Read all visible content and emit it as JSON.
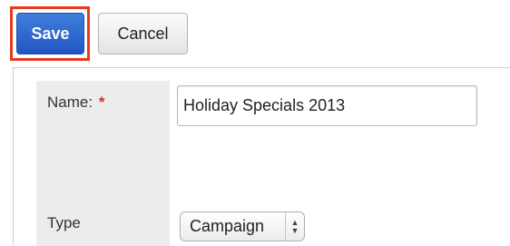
{
  "toolbar": {
    "save_label": "Save",
    "cancel_label": "Cancel",
    "highlight_color": "#e8391d",
    "save_color": "#2a62cc"
  },
  "form": {
    "name_label": "Name:",
    "required_marker": "*",
    "name_value": "Holiday Specials 2013",
    "type_label": "Type",
    "type_value": "Campaign",
    "type_select_icon": "up-down-arrows-icon"
  }
}
